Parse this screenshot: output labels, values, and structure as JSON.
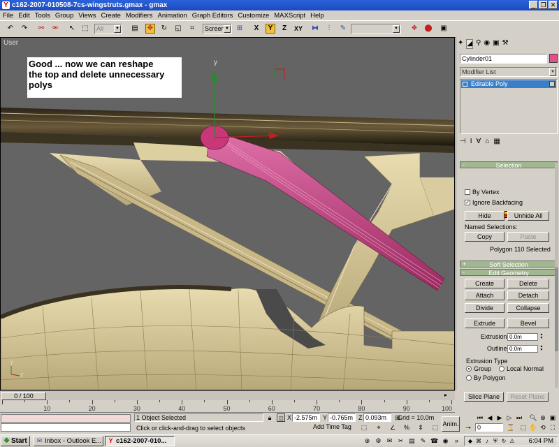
{
  "window": {
    "title": "c162-2007-010508-7cs-wingstruts.gmax - gmax",
    "buttons": [
      "_",
      "❐",
      "✕"
    ]
  },
  "menu": [
    "File",
    "Edit",
    "Tools",
    "Group",
    "Views",
    "Create",
    "Modifiers",
    "Animation",
    "Graph Editors",
    "Customize",
    "MAXScript",
    "Help"
  ],
  "toolbar": {
    "selection_filter": "All",
    "coord_system": "Screen",
    "axis_x": "X",
    "axis_y": "Y",
    "axis_z": "Z",
    "axis_xy": "XY"
  },
  "viewport": {
    "label": "User",
    "note": "Good ... now we can reshape\nthe top and delete unnecessary\npolys",
    "gizmo_y": "y",
    "gizmo_x": "x",
    "axis_y": "y",
    "axis_z": "z"
  },
  "command_panel": {
    "object_name": "Cylinder01",
    "object_color": "#e0508a",
    "modifier_list": "Modifier List",
    "stack_item": "Editable Poly",
    "selection": {
      "header": "Selection",
      "by_vertex": "By Vertex",
      "ignore_backfacing": "Ignore Backfacing",
      "hide": "Hide",
      "unhide_all": "Unhide All",
      "named_selections": "Named Selections:",
      "copy": "Copy",
      "paste": "Paste",
      "status": "Polygon 110 Selected"
    },
    "soft_selection": "Soft Selection",
    "edit_geometry": {
      "header": "Edit Geometry",
      "create": "Create",
      "delete": "Delete",
      "attach": "Attach",
      "detach": "Detach",
      "divide": "Divide",
      "collapse": "Collapse",
      "extrude": "Extrude",
      "bevel": "Bevel",
      "extrusion_label": "Extrusion:",
      "extrusion_value": "0.0m",
      "outline_label": "Outline:",
      "outline_value": "0.0m",
      "extrusion_type": "Extrusion Type",
      "group": "Group",
      "local_normal": "Local Normal",
      "by_polygon": "By Polygon",
      "slice_plane": "Slice Plane",
      "reset_plane": "Reset Plane"
    }
  },
  "timeline": {
    "frame": "0 / 100",
    "ticks": [
      "10",
      "20",
      "30",
      "40",
      "50",
      "60",
      "70",
      "80",
      "90",
      "100"
    ]
  },
  "status": {
    "selected": "1 Object Selected",
    "prompt": "Click or click-and-drag to select objects",
    "x_label": "X",
    "x": "-2.575m",
    "y_label": "Y",
    "y": "-0.765m",
    "z_label": "Z",
    "z": "0.093m",
    "grid": "Grid = 10.0m",
    "add_time_tag": "Add Time Tag",
    "anim": "Anim.",
    "frame_value": "0"
  },
  "taskbar": {
    "start": "Start",
    "tasks": [
      "Inbox - Outlook E...",
      "c162-2007-010..."
    ],
    "clock": "6:04 PM"
  }
}
